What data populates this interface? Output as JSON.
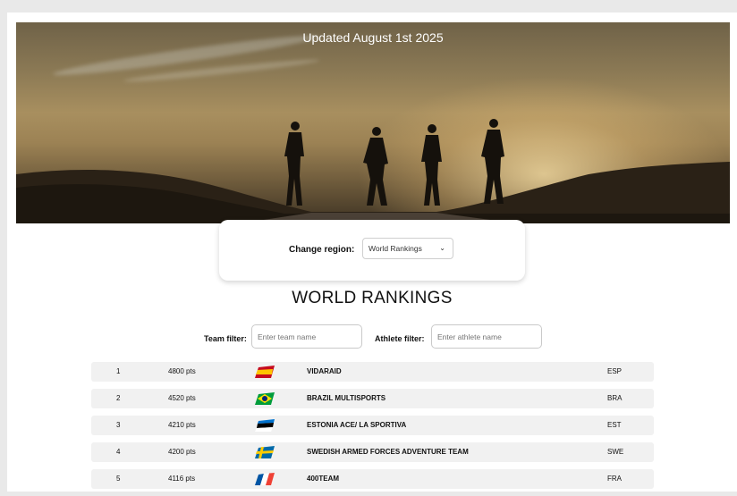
{
  "hero": {
    "title": "Updated August 1st 2025"
  },
  "region": {
    "label": "Change region:",
    "selected": "World Rankings"
  },
  "heading": "WORLD RANKINGS",
  "filters": {
    "team_label": "Team filter:",
    "team_placeholder": "Enter team name",
    "athlete_label": "Athlete filter:",
    "athlete_placeholder": "Enter athlete name"
  },
  "rankings": [
    {
      "rank": "1",
      "points": "4800 pts",
      "flag": "spain-flag-icon",
      "team": "VIDARAID",
      "code": "ESP"
    },
    {
      "rank": "2",
      "points": "4520 pts",
      "flag": "brazil-flag-icon",
      "team": "BRAZIL MULTISPORTS",
      "code": "BRA"
    },
    {
      "rank": "3",
      "points": "4210 pts",
      "flag": "estonia-flag-icon",
      "team": "ESTONIA ACE/ LA SPORTIVA",
      "code": "EST"
    },
    {
      "rank": "4",
      "points": "4200 pts",
      "flag": "sweden-flag-icon",
      "team": "SWEDISH ARMED FORCES ADVENTURE TEAM",
      "code": "SWE"
    },
    {
      "rank": "5",
      "points": "4116 pts",
      "flag": "france-flag-icon",
      "team": "400TEAM",
      "code": "FRA"
    }
  ]
}
